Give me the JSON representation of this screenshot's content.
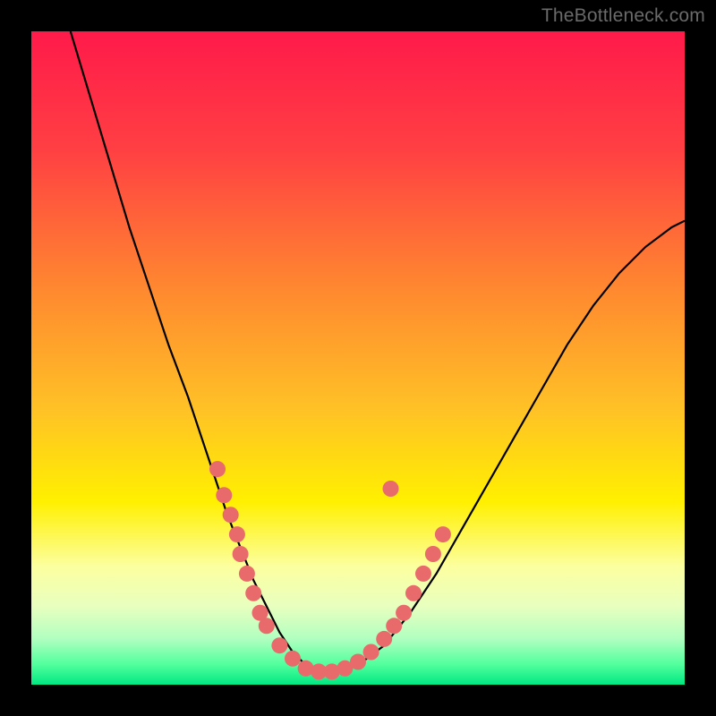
{
  "watermark": "TheBottleneck.com",
  "chart_data": {
    "type": "line",
    "title": "",
    "xlabel": "",
    "ylabel": "",
    "xlim": [
      0,
      100
    ],
    "ylim": [
      0,
      100
    ],
    "gradient_stops": [
      {
        "offset": 0,
        "color": "#ff1a4a"
      },
      {
        "offset": 18,
        "color": "#ff3f43"
      },
      {
        "offset": 40,
        "color": "#ff8a2f"
      },
      {
        "offset": 58,
        "color": "#ffc226"
      },
      {
        "offset": 72,
        "color": "#fff000"
      },
      {
        "offset": 82,
        "color": "#fcffa0"
      },
      {
        "offset": 88,
        "color": "#e8ffbf"
      },
      {
        "offset": 93,
        "color": "#b0ffc0"
      },
      {
        "offset": 97,
        "color": "#4fff9c"
      },
      {
        "offset": 100,
        "color": "#00e882"
      }
    ],
    "series": [
      {
        "name": "bottleneck-curve",
        "x": [
          6,
          9,
          12,
          15,
          18,
          21,
          24,
          26,
          28,
          30,
          32,
          34,
          36,
          38,
          40,
          42,
          44,
          47,
          50,
          54,
          58,
          62,
          66,
          70,
          74,
          78,
          82,
          86,
          90,
          94,
          98,
          100
        ],
        "y": [
          100,
          90,
          80,
          70,
          61,
          52,
          44,
          38,
          32,
          26,
          21,
          16,
          12,
          8,
          5,
          3,
          2,
          2,
          3,
          6,
          11,
          17,
          24,
          31,
          38,
          45,
          52,
          58,
          63,
          67,
          70,
          71
        ]
      }
    ],
    "scatter_points": {
      "name": "highlighted-points",
      "color": "#e86a6a",
      "points": [
        {
          "x": 28.5,
          "y": 33
        },
        {
          "x": 29.5,
          "y": 29
        },
        {
          "x": 30.5,
          "y": 26
        },
        {
          "x": 31.5,
          "y": 23
        },
        {
          "x": 32,
          "y": 20
        },
        {
          "x": 33,
          "y": 17
        },
        {
          "x": 34,
          "y": 14
        },
        {
          "x": 35,
          "y": 11
        },
        {
          "x": 36,
          "y": 9
        },
        {
          "x": 38,
          "y": 6
        },
        {
          "x": 40,
          "y": 4
        },
        {
          "x": 42,
          "y": 2.5
        },
        {
          "x": 44,
          "y": 2
        },
        {
          "x": 46,
          "y": 2
        },
        {
          "x": 48,
          "y": 2.5
        },
        {
          "x": 50,
          "y": 3.5
        },
        {
          "x": 52,
          "y": 5
        },
        {
          "x": 54,
          "y": 7
        },
        {
          "x": 55.5,
          "y": 9
        },
        {
          "x": 57,
          "y": 11
        },
        {
          "x": 58.5,
          "y": 14
        },
        {
          "x": 60,
          "y": 17
        },
        {
          "x": 61.5,
          "y": 20
        },
        {
          "x": 63,
          "y": 23
        },
        {
          "x": 55,
          "y": 30
        }
      ]
    }
  }
}
